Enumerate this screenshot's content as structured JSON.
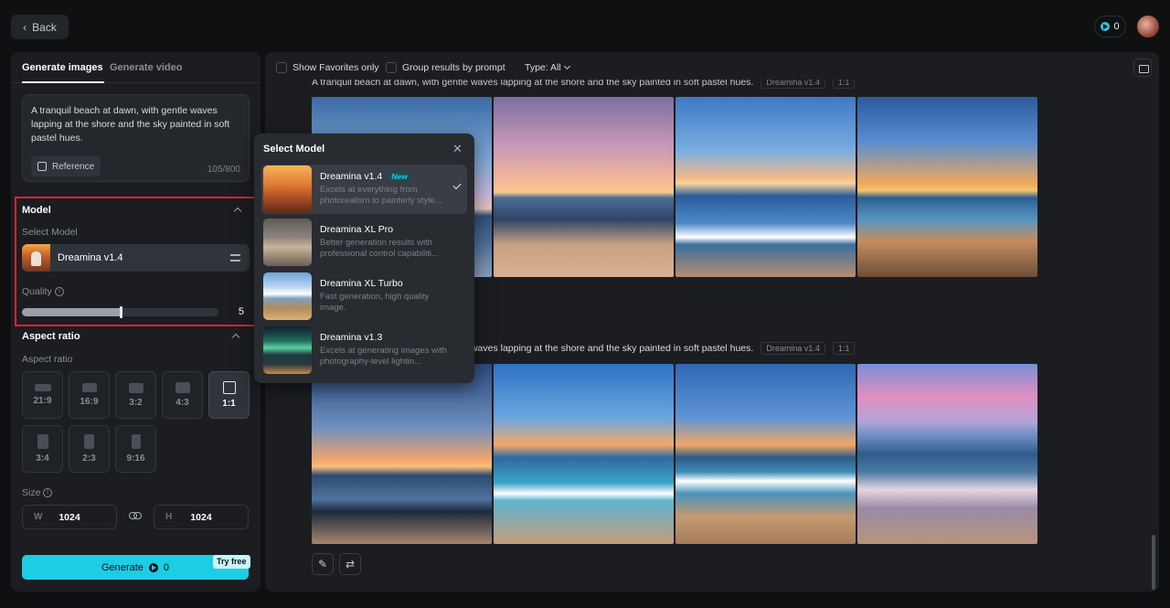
{
  "header": {
    "back_label": "Back",
    "credits": "0"
  },
  "left_panel": {
    "tabs": [
      {
        "label": "Generate images",
        "active": true
      },
      {
        "label": "Generate video",
        "active": false
      }
    ],
    "prompt": {
      "text": "A tranquil beach at dawn, with gentle waves lapping at the shore and the sky painted in soft pastel hues.",
      "reference_label": "Reference",
      "char_count": "105/800"
    },
    "model": {
      "title": "Model",
      "select_label": "Select Model",
      "selected": "Dreamina v1.4"
    },
    "quality": {
      "label": "Quality",
      "value": "5",
      "fraction": 0.5
    },
    "aspect": {
      "title": "Aspect ratio",
      "label": "Aspect ratio",
      "options": [
        "21:9",
        "16:9",
        "3:2",
        "4:3",
        "1:1",
        "3:4",
        "2:3",
        "9:16"
      ],
      "selected": "1:1"
    },
    "size": {
      "label": "Size",
      "w_prefix": "W",
      "w_value": "1024",
      "h_prefix": "H",
      "h_value": "1024"
    },
    "generate": {
      "label": "Generate",
      "cost": "0",
      "badge": "Try free"
    }
  },
  "main": {
    "filters": {
      "favorites_label": "Show Favorites only",
      "group_label": "Group results by prompt",
      "type_label": "Type: All"
    },
    "results": [
      {
        "prompt": "A tranquil beach at dawn, with gentle waves lapping at the shore and the sky painted in soft pastel hues.",
        "model_tag": "Dreamina v1.4",
        "ratio_tag": "1:1"
      },
      {
        "prompt": "A tranquil beach at dawn, with gentle waves lapping at the shore and the sky painted in soft pastel hues.",
        "model_tag": "Dreamina v1.4",
        "ratio_tag": "1:1"
      }
    ]
  },
  "dropdown": {
    "title": "Select Model",
    "items": [
      {
        "name": "Dreamina v1.4",
        "badge": "New",
        "desc": "Excels at everything from photorealism to painterly style...",
        "selected": true
      },
      {
        "name": "Dreamina XL Pro",
        "desc": "Better generation results with professional control capabiliti..."
      },
      {
        "name": "Dreamina XL Turbo",
        "desc": "Fast generation, high quality image."
      },
      {
        "name": "Dreamina v1.3",
        "desc": "Excels at generating images with photography-level lightin..."
      }
    ]
  }
}
